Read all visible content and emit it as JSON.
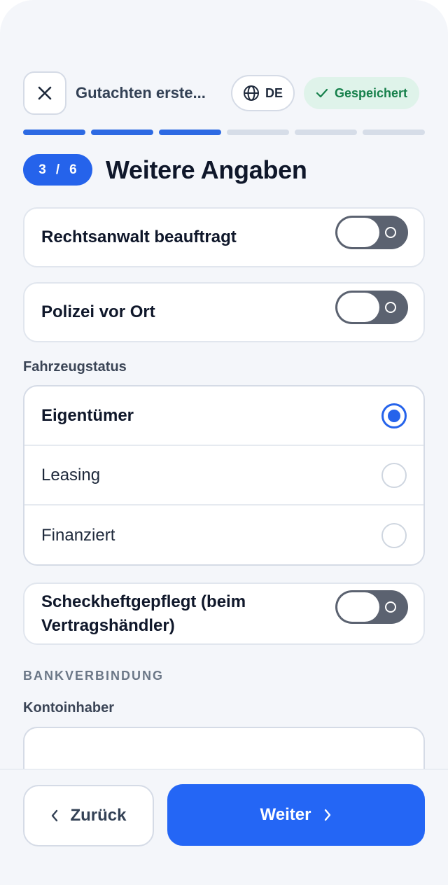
{
  "header": {
    "title": "Gutachten erste...",
    "language": "DE",
    "saved_label": "Gespeichert"
  },
  "progress": {
    "total_steps": 6,
    "completed_steps": 3
  },
  "step": {
    "current": "3",
    "separator": "/",
    "total": "6",
    "title": "Weitere Angaben"
  },
  "toggles": {
    "lawyer": {
      "label": "Rechtsanwalt beauftragt",
      "on": false
    },
    "police": {
      "label": "Polizei vor Ort",
      "on": false
    },
    "service": {
      "label": "Scheckheftgepflegt (beim Vertragshändler)",
      "on": false
    }
  },
  "vehicle_status": {
    "label": "Fahrzeugstatus",
    "options": [
      "Eigentümer",
      "Leasing",
      "Finanziert"
    ],
    "selected": "Eigentümer"
  },
  "bank": {
    "section_label": "BANKVERBINDUNG",
    "account_holder_label": "Kontoinhaber",
    "account_holder_value": ""
  },
  "footer": {
    "back_label": "Zurück",
    "next_label": "Weiter"
  },
  "colors": {
    "accent": "#2563eb",
    "saved_bg": "#dff3ea",
    "saved_text": "#16804b",
    "toggle_off": "#5b6270"
  }
}
